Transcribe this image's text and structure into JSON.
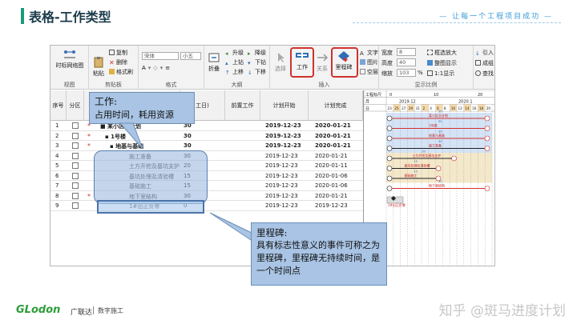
{
  "slide": {
    "title": "表格-工作类型",
    "slogan": "— 让每一个工程项目成功 —"
  },
  "ribbon": {
    "groups": [
      {
        "label": "视图"
      },
      {
        "label": "剪贴板"
      },
      {
        "label": "格式"
      },
      {
        "label": "大纲"
      },
      {
        "label": "插入"
      },
      {
        "label": "显示比例"
      }
    ],
    "view_button": "时标网络图",
    "paste_button": "粘贴",
    "copy": "复制",
    "delete": "删除",
    "format_brush": "格式刷",
    "font_name": "宋体",
    "font_size": "小五",
    "fold_button": "折叠",
    "outline": [
      "升级",
      "降级",
      "上钻",
      "下钻",
      "上移",
      "下移"
    ],
    "select_button": "选择",
    "work_button": "工作",
    "relation_button": "关系",
    "milestone_button": "里程碑",
    "insert_small": [
      "文字",
      "图片",
      "空层"
    ],
    "width_label": "宽度",
    "width_value": "8",
    "height_label": "高度",
    "height_value": "40",
    "zoom_label": "缩放",
    "zoom_value": "103",
    "zoom_unit": "%",
    "frame_zoom": "框选放大",
    "fit_display": "整图显示",
    "one_to_one": "1:1显示",
    "right_small": [
      "引入",
      "成组",
      "查找"
    ]
  },
  "grid": {
    "headers": [
      "序号",
      "分区",
      "",
      "工日)",
      "前置工作",
      "计划开始",
      "计划完成"
    ],
    "rows": [
      {
        "no": "1",
        "star": "*",
        "name": "■ 某小区总计划",
        "duration": "30",
        "start": "2019-12-23",
        "finish": "2020-01-21",
        "bold": true
      },
      {
        "no": "2",
        "star": "*",
        "name": "▪ 1号楼",
        "duration": "30",
        "start": "2019-12-23",
        "finish": "2020-01-21",
        "bold": true
      },
      {
        "no": "3",
        "star": "*",
        "name": "▪ 地基与基础",
        "duration": "30",
        "start": "2019-12-23",
        "finish": "2020-01-21",
        "bold": true
      },
      {
        "no": "4",
        "star": "",
        "name": "施工准备",
        "duration": "30",
        "start": "2019-12-23",
        "finish": "2020-01-21",
        "bold": false
      },
      {
        "no": "5",
        "star": "",
        "name": "土方开挖及基坑支护",
        "duration": "20",
        "start": "2019-12-23",
        "finish": "2020-01-11",
        "bold": false
      },
      {
        "no": "6",
        "star": "",
        "name": "基坑处理及清验槽",
        "duration": "15",
        "start": "2019-12-23",
        "finish": "2020-01-06",
        "bold": false
      },
      {
        "no": "7",
        "star": "",
        "name": "基础施工",
        "duration": "15",
        "start": "2019-12-23",
        "finish": "2020-01-06",
        "bold": false
      },
      {
        "no": "8",
        "star": "*",
        "name": "地下室结构",
        "duration": "30",
        "start": "2019-12-23",
        "finish": "2020-01-21",
        "bold": false
      },
      {
        "no": "9",
        "star": "",
        "name": "1#出正负零",
        "duration": "0",
        "start": "2019-12-23",
        "finish": "2019-12-23",
        "bold": false
      }
    ]
  },
  "gantt": {
    "rows_label": [
      "工程标尺",
      "月",
      "日"
    ],
    "year_ticks": [
      "0",
      "10",
      "20"
    ],
    "month_ticks": [
      "2019.12",
      "2020.1"
    ],
    "day_ticks": [
      "23",
      "25",
      "27",
      "29",
      "31",
      "2",
      "4",
      "6",
      "8",
      "10",
      "12",
      "14",
      "16",
      "18",
      "20"
    ],
    "bars": [
      {
        "label": "某小区总计划",
        "num": "30"
      },
      {
        "label": "1号楼",
        "num": "30"
      },
      {
        "label": "地基与基础",
        "num": "30"
      },
      {
        "label": "施工准备",
        "num": "30"
      },
      {
        "label": "土方开挖及基坑支护",
        "num": "20"
      },
      {
        "label": "基坑处理及清验槽",
        "num": "15"
      },
      {
        "label": "基础施工",
        "num": "15"
      },
      {
        "label": "地下室结构",
        "num": "30"
      },
      {
        "label": "1#出正负零",
        "num": ""
      }
    ]
  },
  "callouts": {
    "work_title": "工作:",
    "work_desc": "占用时间，耗用资源",
    "milestone_title": "里程碑:",
    "milestone_desc": "具有标志性意义的事件可称之为里程碑，里程碑无持续时间，是一个时间点"
  },
  "footer": {
    "logo_en": "GLodon",
    "logo_cn": "广联达",
    "logo_sub": "数字施工",
    "watermark": "知乎 @斑马进度计划"
  },
  "colors": {
    "accent_green": "#2d9d3a",
    "highlight_red": "#d0312d",
    "callout_blue": "#a9c4e4",
    "gantt_blue": "#cfe0f4",
    "gantt_tan": "#f3e6c4"
  }
}
